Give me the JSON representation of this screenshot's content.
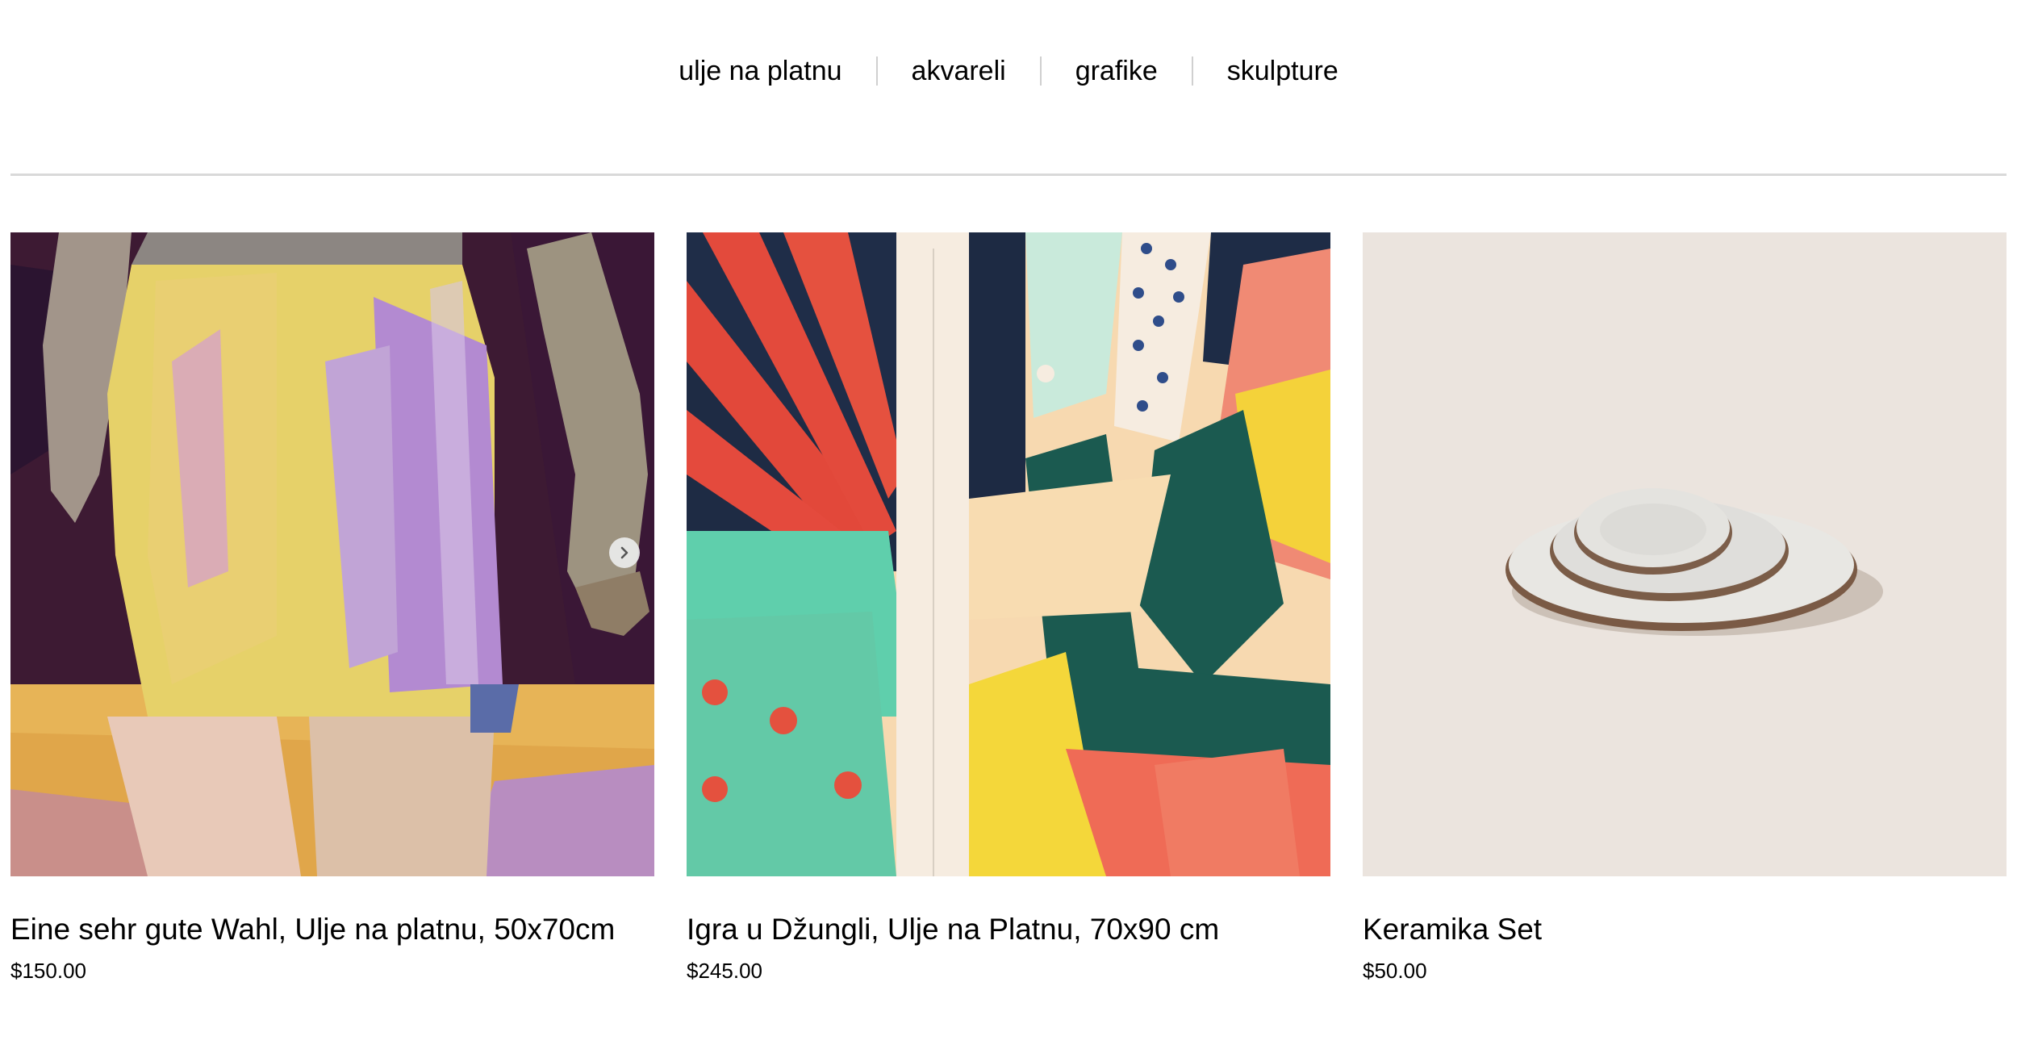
{
  "nav": {
    "items": [
      {
        "label": "ulje na platnu"
      },
      {
        "label": "akvareli"
      },
      {
        "label": "grafike"
      },
      {
        "label": "skulpture"
      }
    ],
    "separator_color": "#d0d0d0"
  },
  "products": [
    {
      "title": "Eine sehr gute Wahl, Ulje na platnu, 50x70cm",
      "price": "$150.00",
      "image": "painting-yellow-shorts",
      "has_next_arrow": true
    },
    {
      "title": "Igra u Džungli, Ulje na Platnu, 70x90 cm",
      "price": "$245.00",
      "image": "painting-jungle-abstract"
    },
    {
      "title": "Keramika Set",
      "price": "$50.00",
      "image": "ceramic-plates-photo"
    }
  ],
  "icons": {
    "carousel_next": "chevron-right-icon"
  }
}
